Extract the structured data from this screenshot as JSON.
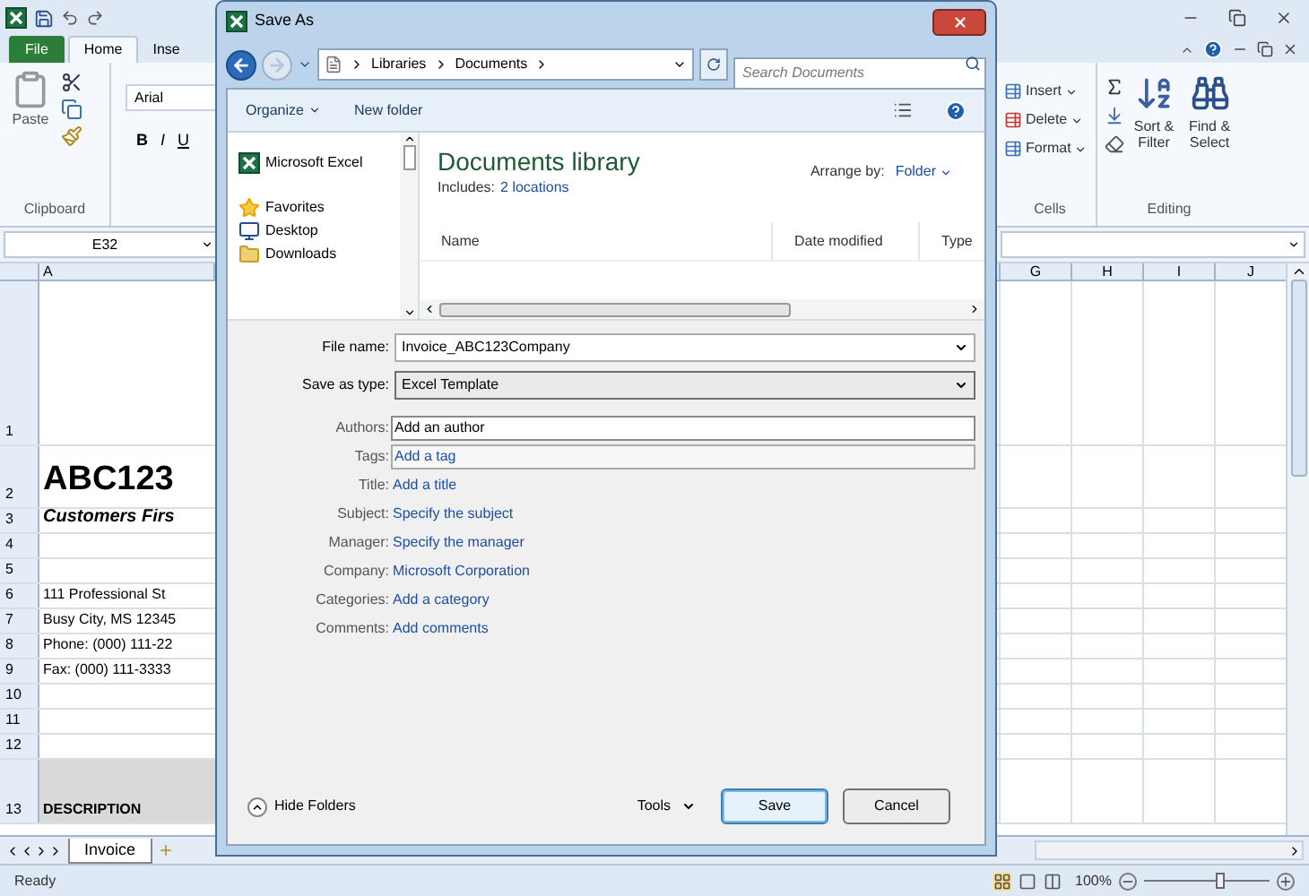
{
  "excel": {
    "tabs": [
      {
        "label": "File",
        "selected": false,
        "kind": "file"
      },
      {
        "label": "Home",
        "selected": true,
        "kind": "tab"
      },
      {
        "label": "Inse",
        "selected": false,
        "kind": "tab"
      }
    ],
    "clipboard": {
      "paste": "Paste",
      "label": "Clipboard"
    },
    "font": {
      "name": "Arial",
      "styles": [
        "B",
        "I",
        "U"
      ]
    },
    "cells": {
      "items": [
        "Insert",
        "Delete",
        "Format"
      ],
      "label": "Cells"
    },
    "editing": {
      "items": [
        "Sort & Filter",
        "Find & Select"
      ],
      "label": "Editing"
    },
    "name_box": "E32",
    "columns_left": [
      "A"
    ],
    "columns_right": [
      "G",
      "H",
      "I",
      "J"
    ],
    "rows": [
      {
        "number": "1",
        "kind": "blank"
      },
      {
        "number": "2",
        "kind": "title",
        "text": "ABC123"
      },
      {
        "number": "3",
        "kind": "subtitle",
        "text": "Customers Firs"
      },
      {
        "number": "4",
        "kind": "blank"
      },
      {
        "number": "5",
        "kind": "blank"
      },
      {
        "number": "6",
        "kind": "plain",
        "text": "111 Professional St"
      },
      {
        "number": "7",
        "kind": "plain",
        "text": "Busy City, MS 12345"
      },
      {
        "number": "8",
        "kind": "plain",
        "text": "Phone: (000) 111-22"
      },
      {
        "number": "9",
        "kind": "plain",
        "text": "Fax: (000) 111-3333"
      },
      {
        "number": "10",
        "kind": "blank"
      },
      {
        "number": "11",
        "kind": "blank"
      },
      {
        "number": "12",
        "kind": "blank"
      },
      {
        "number": "13",
        "kind": "header",
        "text": "DESCRIPTION"
      }
    ],
    "sheet_tabs": [
      {
        "label": "Invoice",
        "selected": true
      }
    ],
    "status": "Ready",
    "zoom": {
      "reading": "100%",
      "level": 0.62
    }
  },
  "dialog": {
    "title": "Save As",
    "breadcrumbs": [
      "Libraries",
      "Documents"
    ],
    "search": {
      "placeholder": "Search Documents"
    },
    "toolbar": [
      "Organize",
      "New folder"
    ],
    "nav_items": [
      {
        "label": "Microsoft Excel",
        "kind": "excel"
      },
      {
        "label": "Favorites",
        "kind": "star"
      },
      {
        "label": "Desktop",
        "kind": "desktop"
      },
      {
        "label": "Downloads",
        "kind": "downloads"
      }
    ],
    "library": {
      "title": "Documents library",
      "includes_label": "Includes:",
      "includes_link": "2 locations",
      "arrange_label": "Arrange by:",
      "arrange_value": "Folder"
    },
    "columns": [
      "Name",
      "Date modified",
      "Type"
    ],
    "file_name": {
      "label": "File name:",
      "value": "Invoice_ABC123Company"
    },
    "save_type": {
      "label": "Save as type:",
      "value": "Excel Template"
    },
    "properties": [
      {
        "label": "Authors:",
        "value": "Add an author",
        "kind": "input"
      },
      {
        "label": "Tags:",
        "value": "Add a tag",
        "kind": "boxed-link"
      },
      {
        "label": "Title:",
        "value": "Add a title",
        "kind": "link"
      },
      {
        "label": "Subject:",
        "value": "Specify the subject",
        "kind": "link"
      },
      {
        "label": "Manager:",
        "value": "Specify the manager",
        "kind": "link"
      },
      {
        "label": "Company:",
        "value": "Microsoft Corporation",
        "kind": "link"
      },
      {
        "label": "Categories:",
        "value": "Add a category",
        "kind": "link"
      },
      {
        "label": "Comments:",
        "value": "Add comments",
        "kind": "link"
      }
    ],
    "hide_folders": "Hide Folders",
    "tools": "Tools",
    "buttons": [
      {
        "label": "Save",
        "kind": "default"
      },
      {
        "label": "Cancel",
        "kind": "normal"
      }
    ]
  }
}
